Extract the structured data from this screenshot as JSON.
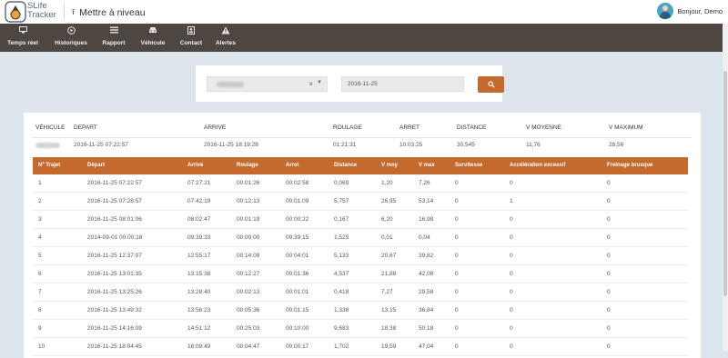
{
  "app": {
    "logo_line1": "SLife",
    "logo_line2": "Tracker",
    "upgrade_label": "Mettre à niveau",
    "upgrade_icon": "upload-icon",
    "user_greeting": "Bonjour, Demo",
    "accent": "#c46a2f",
    "nav_bg": "#4e4641"
  },
  "nav": [
    {
      "label": "Temps réel",
      "icon": "monitor-icon"
    },
    {
      "label": "Historiques",
      "icon": "play-circle-icon"
    },
    {
      "label": "Rapport",
      "icon": "list-icon"
    },
    {
      "label": "Véhicule",
      "icon": "car-icon"
    },
    {
      "label": "Contact",
      "icon": "contact-card-icon"
    },
    {
      "label": "Alertes",
      "icon": "warning-icon"
    }
  ],
  "filter": {
    "vehicle_clear": "×",
    "date_value": "2016-11-25",
    "search_icon": "search-icon"
  },
  "summary": {
    "headers": [
      "VÉHICULE",
      "DEPART",
      "ARRIVE",
      "ROULAGE",
      "ARRET",
      "DISTANCE",
      "V MOYENNE",
      "V MAXIMUM"
    ],
    "values": [
      "",
      "2016-11-25 07:22:57",
      "2016-11-25 18:19:28",
      "01:21:31",
      "10:03:25",
      "30,545",
      "11,76",
      "28,56"
    ]
  },
  "table": {
    "headers": [
      "Nº Trajet",
      "Départ",
      "Arrivé",
      "Roulage",
      "Arret",
      "Distance",
      "V moy",
      "V max",
      "Survitesse",
      "Accélération excessif",
      "Freinage brusque"
    ],
    "rows": [
      [
        "1",
        "2016-11-25 07:22:57",
        "07:27:21",
        "00:01:26",
        "00:02:58",
        "0,069",
        "1,20",
        "7,26",
        "0",
        "0",
        "0"
      ],
      [
        "2",
        "2016-11-25 07:28:57",
        "07:42:19",
        "00:12:13",
        "00:01:09",
        "5,757",
        "26,95",
        "53,14",
        "0",
        "1",
        "0"
      ],
      [
        "3",
        "2016-11-25 08:01:06",
        "08:02:47",
        "00:01:19",
        "00:00:22",
        "0,167",
        "6,20",
        "16,98",
        "0",
        "0",
        "0"
      ],
      [
        "4",
        "2014-09-01 00:00:18",
        "09:39:33",
        "00:00:00",
        "09:39:15",
        "1,525",
        "0,01",
        "0,04",
        "0",
        "0",
        "0"
      ],
      [
        "5",
        "2016-11-25 12:37:07",
        "12:55:17",
        "00:14:09",
        "00:04:01",
        "5,133",
        "20,67",
        "39,82",
        "0",
        "0",
        "0"
      ],
      [
        "6",
        "2016-11-25 13:01:35",
        "13:15:38",
        "00:12:27",
        "00:01:36",
        "4,537",
        "21,88",
        "42,08",
        "0",
        "0",
        "0"
      ],
      [
        "7",
        "2016-11-25 13:25:26",
        "13:28:40",
        "00:02:13",
        "00:01:01",
        "0,418",
        "7,27",
        "29,58",
        "0",
        "0",
        "0"
      ],
      [
        "8",
        "2016-11-25 13:49:32",
        "13:56:23",
        "00:05:36",
        "00:01:15",
        "1,338",
        "13,15",
        "36,84",
        "0",
        "0",
        "0"
      ],
      [
        "9",
        "2016-11-25 14:16:09",
        "14:51:12",
        "00:25:03",
        "00:10:00",
        "9,683",
        "18,38",
        "50,18",
        "0",
        "0",
        "0"
      ],
      [
        "10",
        "2016-11-25 18:04:45",
        "18:09:49",
        "00:04:47",
        "00:00:17",
        "1,702",
        "19,59",
        "47,04",
        "0",
        "0",
        "0"
      ]
    ]
  }
}
